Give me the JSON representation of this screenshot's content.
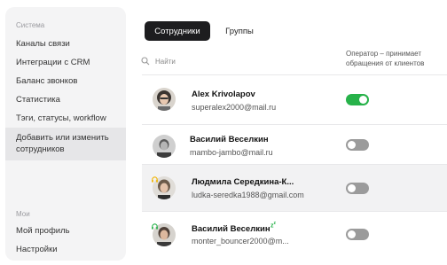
{
  "sidebar": {
    "section_system": "Система",
    "items_system": [
      "Каналы связи",
      "Интеграции с CRM",
      "Баланс звонков",
      "Статистика",
      "Тэги, статусы, workflow",
      "Добавить или изменить сотрудников"
    ],
    "section_my": "Мои",
    "items_my": [
      "Мой профиль",
      "Настройки"
    ]
  },
  "tabs": {
    "employees": "Сотрудники",
    "groups": "Группы"
  },
  "search": {
    "placeholder": "Найти"
  },
  "column_operator": "Оператор – принимает обращения от клиентов",
  "employees": [
    {
      "name": "Alex Krivolapov",
      "email": "superalex2000@mail.ru",
      "operator": true
    },
    {
      "name": "Василий Веселкин",
      "email": "mambo-jambo@mail.ru",
      "operator": false
    },
    {
      "name": "Людмила Середкина-К...",
      "email": "ludka-seredka1988@gmail.com",
      "operator": false
    },
    {
      "name": "Василий Веселкин",
      "email": "monter_bouncer2000@m...",
      "operator": false
    }
  ],
  "colors": {
    "toggle_on": "#27b24a",
    "toggle_off": "#9b9b9b",
    "active_tab": "#1d1d1f",
    "headset_badge_yellow": "#f0b400",
    "headset_badge_green": "#27b24a"
  },
  "icons": [
    "search-icon",
    "headset-icon",
    "sleep-icon"
  ]
}
